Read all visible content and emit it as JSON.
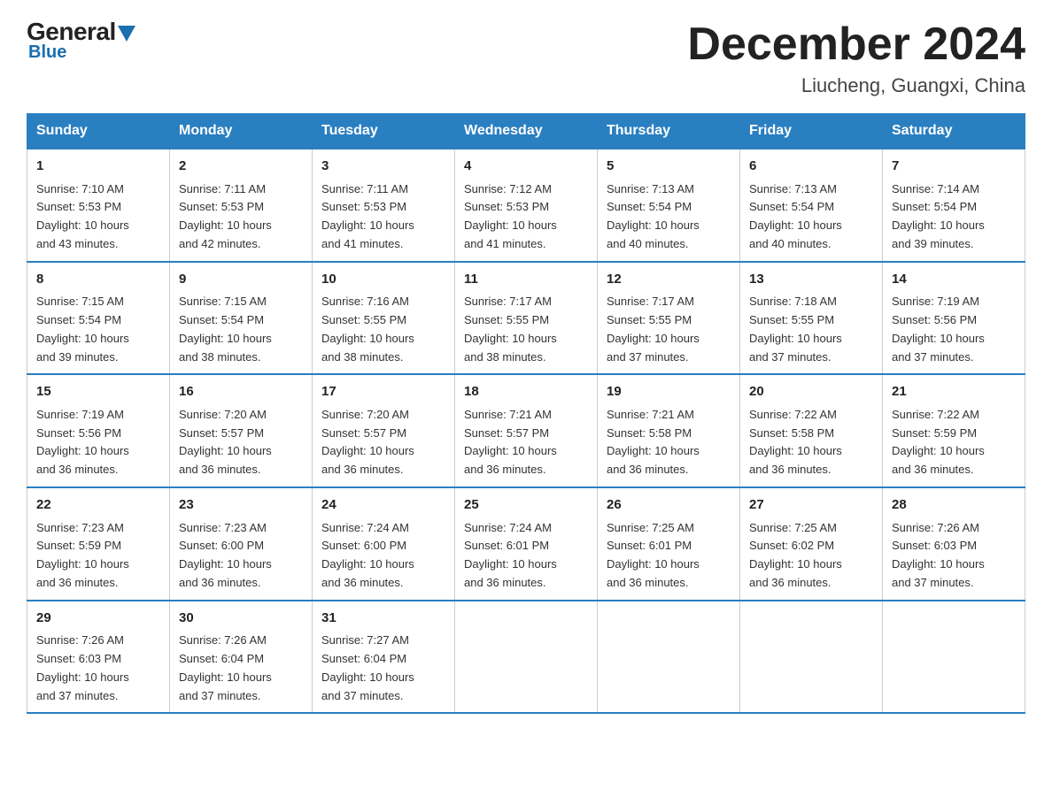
{
  "logo": {
    "name_part1": "General",
    "name_part2": "Blue"
  },
  "title": "December 2024",
  "subtitle": "Liucheng, Guangxi, China",
  "weekdays": [
    "Sunday",
    "Monday",
    "Tuesday",
    "Wednesday",
    "Thursday",
    "Friday",
    "Saturday"
  ],
  "weeks": [
    [
      {
        "day": "1",
        "sunrise": "7:10 AM",
        "sunset": "5:53 PM",
        "daylight": "10 hours and 43 minutes."
      },
      {
        "day": "2",
        "sunrise": "7:11 AM",
        "sunset": "5:53 PM",
        "daylight": "10 hours and 42 minutes."
      },
      {
        "day": "3",
        "sunrise": "7:11 AM",
        "sunset": "5:53 PM",
        "daylight": "10 hours and 41 minutes."
      },
      {
        "day": "4",
        "sunrise": "7:12 AM",
        "sunset": "5:53 PM",
        "daylight": "10 hours and 41 minutes."
      },
      {
        "day": "5",
        "sunrise": "7:13 AM",
        "sunset": "5:54 PM",
        "daylight": "10 hours and 40 minutes."
      },
      {
        "day": "6",
        "sunrise": "7:13 AM",
        "sunset": "5:54 PM",
        "daylight": "10 hours and 40 minutes."
      },
      {
        "day": "7",
        "sunrise": "7:14 AM",
        "sunset": "5:54 PM",
        "daylight": "10 hours and 39 minutes."
      }
    ],
    [
      {
        "day": "8",
        "sunrise": "7:15 AM",
        "sunset": "5:54 PM",
        "daylight": "10 hours and 39 minutes."
      },
      {
        "day": "9",
        "sunrise": "7:15 AM",
        "sunset": "5:54 PM",
        "daylight": "10 hours and 38 minutes."
      },
      {
        "day": "10",
        "sunrise": "7:16 AM",
        "sunset": "5:55 PM",
        "daylight": "10 hours and 38 minutes."
      },
      {
        "day": "11",
        "sunrise": "7:17 AM",
        "sunset": "5:55 PM",
        "daylight": "10 hours and 38 minutes."
      },
      {
        "day": "12",
        "sunrise": "7:17 AM",
        "sunset": "5:55 PM",
        "daylight": "10 hours and 37 minutes."
      },
      {
        "day": "13",
        "sunrise": "7:18 AM",
        "sunset": "5:55 PM",
        "daylight": "10 hours and 37 minutes."
      },
      {
        "day": "14",
        "sunrise": "7:19 AM",
        "sunset": "5:56 PM",
        "daylight": "10 hours and 37 minutes."
      }
    ],
    [
      {
        "day": "15",
        "sunrise": "7:19 AM",
        "sunset": "5:56 PM",
        "daylight": "10 hours and 36 minutes."
      },
      {
        "day": "16",
        "sunrise": "7:20 AM",
        "sunset": "5:57 PM",
        "daylight": "10 hours and 36 minutes."
      },
      {
        "day": "17",
        "sunrise": "7:20 AM",
        "sunset": "5:57 PM",
        "daylight": "10 hours and 36 minutes."
      },
      {
        "day": "18",
        "sunrise": "7:21 AM",
        "sunset": "5:57 PM",
        "daylight": "10 hours and 36 minutes."
      },
      {
        "day": "19",
        "sunrise": "7:21 AM",
        "sunset": "5:58 PM",
        "daylight": "10 hours and 36 minutes."
      },
      {
        "day": "20",
        "sunrise": "7:22 AM",
        "sunset": "5:58 PM",
        "daylight": "10 hours and 36 minutes."
      },
      {
        "day": "21",
        "sunrise": "7:22 AM",
        "sunset": "5:59 PM",
        "daylight": "10 hours and 36 minutes."
      }
    ],
    [
      {
        "day": "22",
        "sunrise": "7:23 AM",
        "sunset": "5:59 PM",
        "daylight": "10 hours and 36 minutes."
      },
      {
        "day": "23",
        "sunrise": "7:23 AM",
        "sunset": "6:00 PM",
        "daylight": "10 hours and 36 minutes."
      },
      {
        "day": "24",
        "sunrise": "7:24 AM",
        "sunset": "6:00 PM",
        "daylight": "10 hours and 36 minutes."
      },
      {
        "day": "25",
        "sunrise": "7:24 AM",
        "sunset": "6:01 PM",
        "daylight": "10 hours and 36 minutes."
      },
      {
        "day": "26",
        "sunrise": "7:25 AM",
        "sunset": "6:01 PM",
        "daylight": "10 hours and 36 minutes."
      },
      {
        "day": "27",
        "sunrise": "7:25 AM",
        "sunset": "6:02 PM",
        "daylight": "10 hours and 36 minutes."
      },
      {
        "day": "28",
        "sunrise": "7:26 AM",
        "sunset": "6:03 PM",
        "daylight": "10 hours and 37 minutes."
      }
    ],
    [
      {
        "day": "29",
        "sunrise": "7:26 AM",
        "sunset": "6:03 PM",
        "daylight": "10 hours and 37 minutes."
      },
      {
        "day": "30",
        "sunrise": "7:26 AM",
        "sunset": "6:04 PM",
        "daylight": "10 hours and 37 minutes."
      },
      {
        "day": "31",
        "sunrise": "7:27 AM",
        "sunset": "6:04 PM",
        "daylight": "10 hours and 37 minutes."
      },
      null,
      null,
      null,
      null
    ]
  ],
  "labels": {
    "sunrise": "Sunrise:",
    "sunset": "Sunset:",
    "daylight": "Daylight:"
  }
}
